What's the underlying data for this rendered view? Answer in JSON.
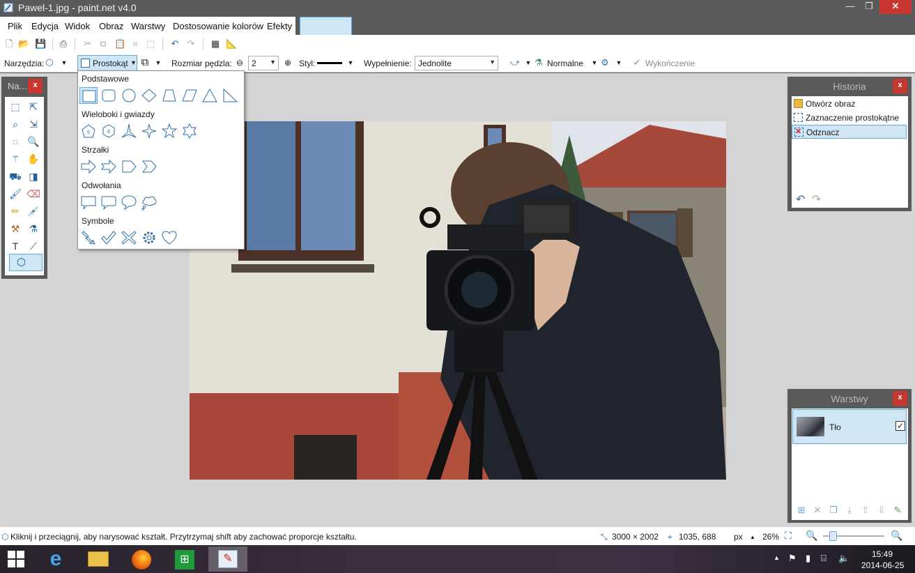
{
  "window": {
    "title": "Pawel-1.jpg - paint.net v4.0",
    "min_glyph": "—",
    "max_glyph": "❐",
    "close_glyph": "✕"
  },
  "menu": [
    "Plik",
    "Edycja",
    "Widok",
    "Obraz",
    "Warstwy",
    "Dostosowanie kolorów",
    "Efekty"
  ],
  "toolbar_options": {
    "tools_label": "Narzędzia:",
    "shape_label": "Prostokąt",
    "brush_size_label": "Rozmiar pędzla:",
    "brush_size_value": "2",
    "style_label": "Styl:",
    "fill_label": "Wypełnienie:",
    "fill_value": "Jednolite",
    "blend_value": "Normalne",
    "finish_label": "Wykończenie"
  },
  "tools_panel": {
    "title": "Na...",
    "close": "x"
  },
  "shape_popup": {
    "groups": [
      {
        "title": "Podstawowe",
        "shapes": [
          "rectangle",
          "rounded-rectangle",
          "ellipse",
          "diamond",
          "trapezoid",
          "parallelogram",
          "triangle",
          "right-triangle"
        ]
      },
      {
        "title": "Wieloboki i gwiazdy",
        "shapes": [
          "pentagon",
          "hexagon",
          "three-point-star",
          "four-point-star",
          "five-point-star",
          "six-point-star"
        ],
        "labels": [
          "5",
          "6"
        ]
      },
      {
        "title": "Strzałki",
        "shapes": [
          "arrow",
          "double-chevron-arrow",
          "pentagon-arrow",
          "chevron"
        ]
      },
      {
        "title": "Odwołania",
        "shapes": [
          "rectangle-callout",
          "rounded-callout",
          "oval-callout",
          "cloud-callout"
        ]
      },
      {
        "title": "Symbole",
        "shapes": [
          "lightning",
          "checkmark",
          "x-mark",
          "gear",
          "heart"
        ]
      }
    ]
  },
  "history": {
    "title": "Historia",
    "close": "x",
    "items": [
      "Otwórz obraz",
      "Zaznaczenie prostokątne",
      "Odznacz"
    ]
  },
  "layers": {
    "title": "Warstwy",
    "close": "x",
    "layer_name": "Tło",
    "visible": true
  },
  "status": {
    "hint": "Kliknij i przeciągnij, aby narysować kształt. Przytrzymaj shift aby zachować proporcje kształtu.",
    "image_size": "3000 × 2002",
    "cursor_pos": "1035, 688",
    "units": "px",
    "zoom": "26%",
    "zoom_fraction": 0.26
  },
  "taskbar": {
    "time": "15:49",
    "date": "2014-06-25"
  },
  "colors": {
    "accent": "#5fa8e0",
    "selection_bg": "#cfe6f7",
    "close_red": "#c7372f"
  }
}
